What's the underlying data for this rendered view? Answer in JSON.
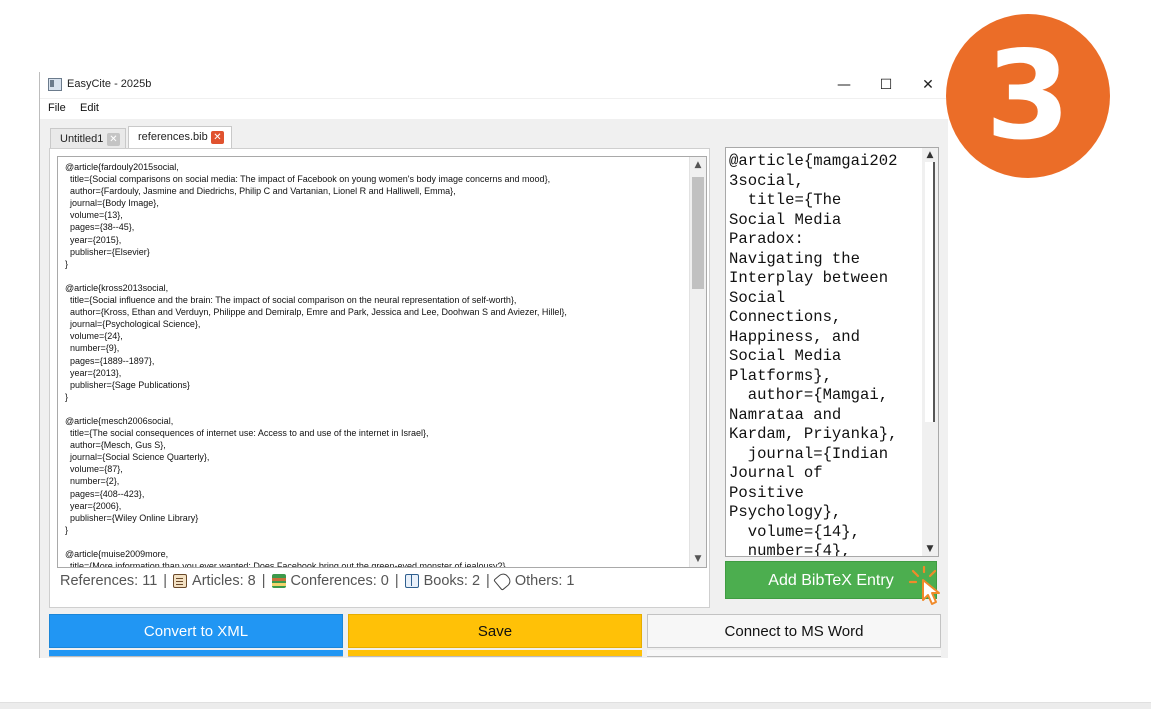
{
  "window": {
    "title": "EasyCite - 2025b",
    "controls": {
      "minimize": "—",
      "maximize": "☐",
      "close": "✕"
    }
  },
  "menu": [
    "File",
    "Edit"
  ],
  "tabs": [
    {
      "label": "Untitled1",
      "close": "✕",
      "active": false
    },
    {
      "label": "references.bib",
      "close": "✕",
      "active": true
    }
  ],
  "editor": {
    "content": "@article{fardouly2015social,\n  title={Social comparisons on social media: The impact of Facebook on young women's body image concerns and mood},\n  author={Fardouly, Jasmine and Diedrichs, Philip C and Vartanian, Lionel R and Halliwell, Emma},\n  journal={Body Image},\n  volume={13},\n  pages={38--45},\n  year={2015},\n  publisher={Elsevier}\n}\n\n@article{kross2013social,\n  title={Social influence and the brain: The impact of social comparison on the neural representation of self-worth},\n  author={Kross, Ethan and Verduyn, Philippe and Demiralp, Emre and Park, Jessica and Lee, Doohwan S and Aviezer, Hillel},\n  journal={Psychological Science},\n  volume={24},\n  number={9},\n  pages={1889--1897},\n  year={2013},\n  publisher={Sage Publications}\n}\n\n@article{mesch2006social,\n  title={The social consequences of internet use: Access to and use of the internet in Israel},\n  author={Mesch, Gus S},\n  journal={Social Science Quarterly},\n  volume={87},\n  number={2},\n  pages={408--423},\n  year={2006},\n  publisher={Wiley Online Library}\n}\n\n@article{muise2009more,\n  title={More information than you ever wanted: Does Facebook bring out the green-eyed monster of jealousy?},",
    "scroll_up": "▲",
    "scroll_down": "▼"
  },
  "stats": {
    "references": "References: 11",
    "articles": "Articles: 8",
    "conferences": "Conferences: 0",
    "books": "Books: 2",
    "others": "Others: 1",
    "separator": "|",
    "icons": [
      "scroll-icon",
      "books-icon",
      "book-icon",
      "tag-icon"
    ]
  },
  "entry_box": {
    "content": "@article{mamgai202\n3social,\n  title={The\nSocial Media\nParadox:\nNavigating the\nInterplay between\nSocial\nConnections,\nHappiness, and\nSocial Media\nPlatforms},\n  author={Mamgai,\nNamrataa and\nKardam, Priyanka},\n  journal={Indian\nJournal of\nPositive\nPsychology},\n  volume={14},\n  number={4},",
    "scroll_up": "▲",
    "scroll_down": "▼"
  },
  "buttons": {
    "add_entry": "Add BibTeX Entry",
    "convert_xml": "Convert to XML",
    "save": "Save",
    "connect_word": "Connect to MS Word"
  },
  "step_badge": "3",
  "colors": {
    "add_entry": "#4cae4f",
    "convert_xml": "#2196f3",
    "save": "#ffc107",
    "badge": "#eb6d28",
    "tab_close_active": "#e0522f"
  }
}
